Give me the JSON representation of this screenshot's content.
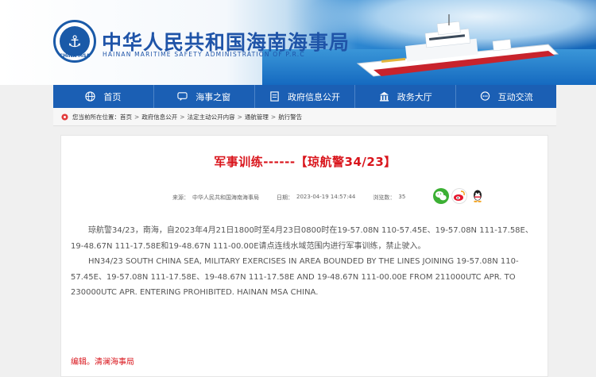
{
  "site": {
    "title": "中华人民共和国海南海事局",
    "subtitle": "HAINAN MARITIME SAFETY ADMINISTRATION OF P.R.C",
    "logo_text": "CHINA MSA"
  },
  "nav": {
    "items": [
      {
        "label": "首页",
        "icon": "globe-icon"
      },
      {
        "label": "海事之窗",
        "icon": "chat-icon"
      },
      {
        "label": "政府信息公开",
        "icon": "document-icon"
      },
      {
        "label": "政务大厅",
        "icon": "building-icon"
      },
      {
        "label": "互动交流",
        "icon": "speech-icon"
      }
    ]
  },
  "breadcrumb": {
    "prefix": "您当前所在位置：",
    "items": [
      "首页",
      "政府信息公开",
      "法定主动公开内容",
      "通航管理",
      "航行警告"
    ],
    "separator": ">"
  },
  "article": {
    "title": "军事训练------【琼航警34/23】",
    "source_label": "来源：",
    "source": "中华人民共和国海南海事局",
    "date_label": "日期：",
    "date": "2023-04-19 14:57:44",
    "views_label": "浏览数：",
    "views": "35",
    "paragraph_cn": "琼航警34/23，南海，自2023年4月21日1800时至4月23日0800时在19-57.08N 110-57.45E、19-57.08N 111-17.58E、19-48.67N 111-17.58E和19-48.67N 111-00.00E请点连线水域范围内进行军事训练，禁止驶入。",
    "paragraph_en": "HN34/23 SOUTH CHINA SEA, MILITARY EXERCISES IN AREA BOUNDED BY THE LINES JOINING 19-57.08N 110-57.45E、19-57.08N 111-17.58E、19-48.67N 111-17.58E AND 19-48.67N 111-00.00E FROM 211000UTC APR. TO 230000UTC APR. ENTERING PROHIBITED. HAINAN MSA CHINA.",
    "editor": "编辑。清澜海事局"
  },
  "share": {
    "items": [
      "wechat-icon",
      "weibo-icon",
      "qq-icon"
    ]
  },
  "colors": {
    "nav_bg": "#1b5fb4",
    "title_red": "#d9151c",
    "brand_blue": "#1f54a8"
  }
}
